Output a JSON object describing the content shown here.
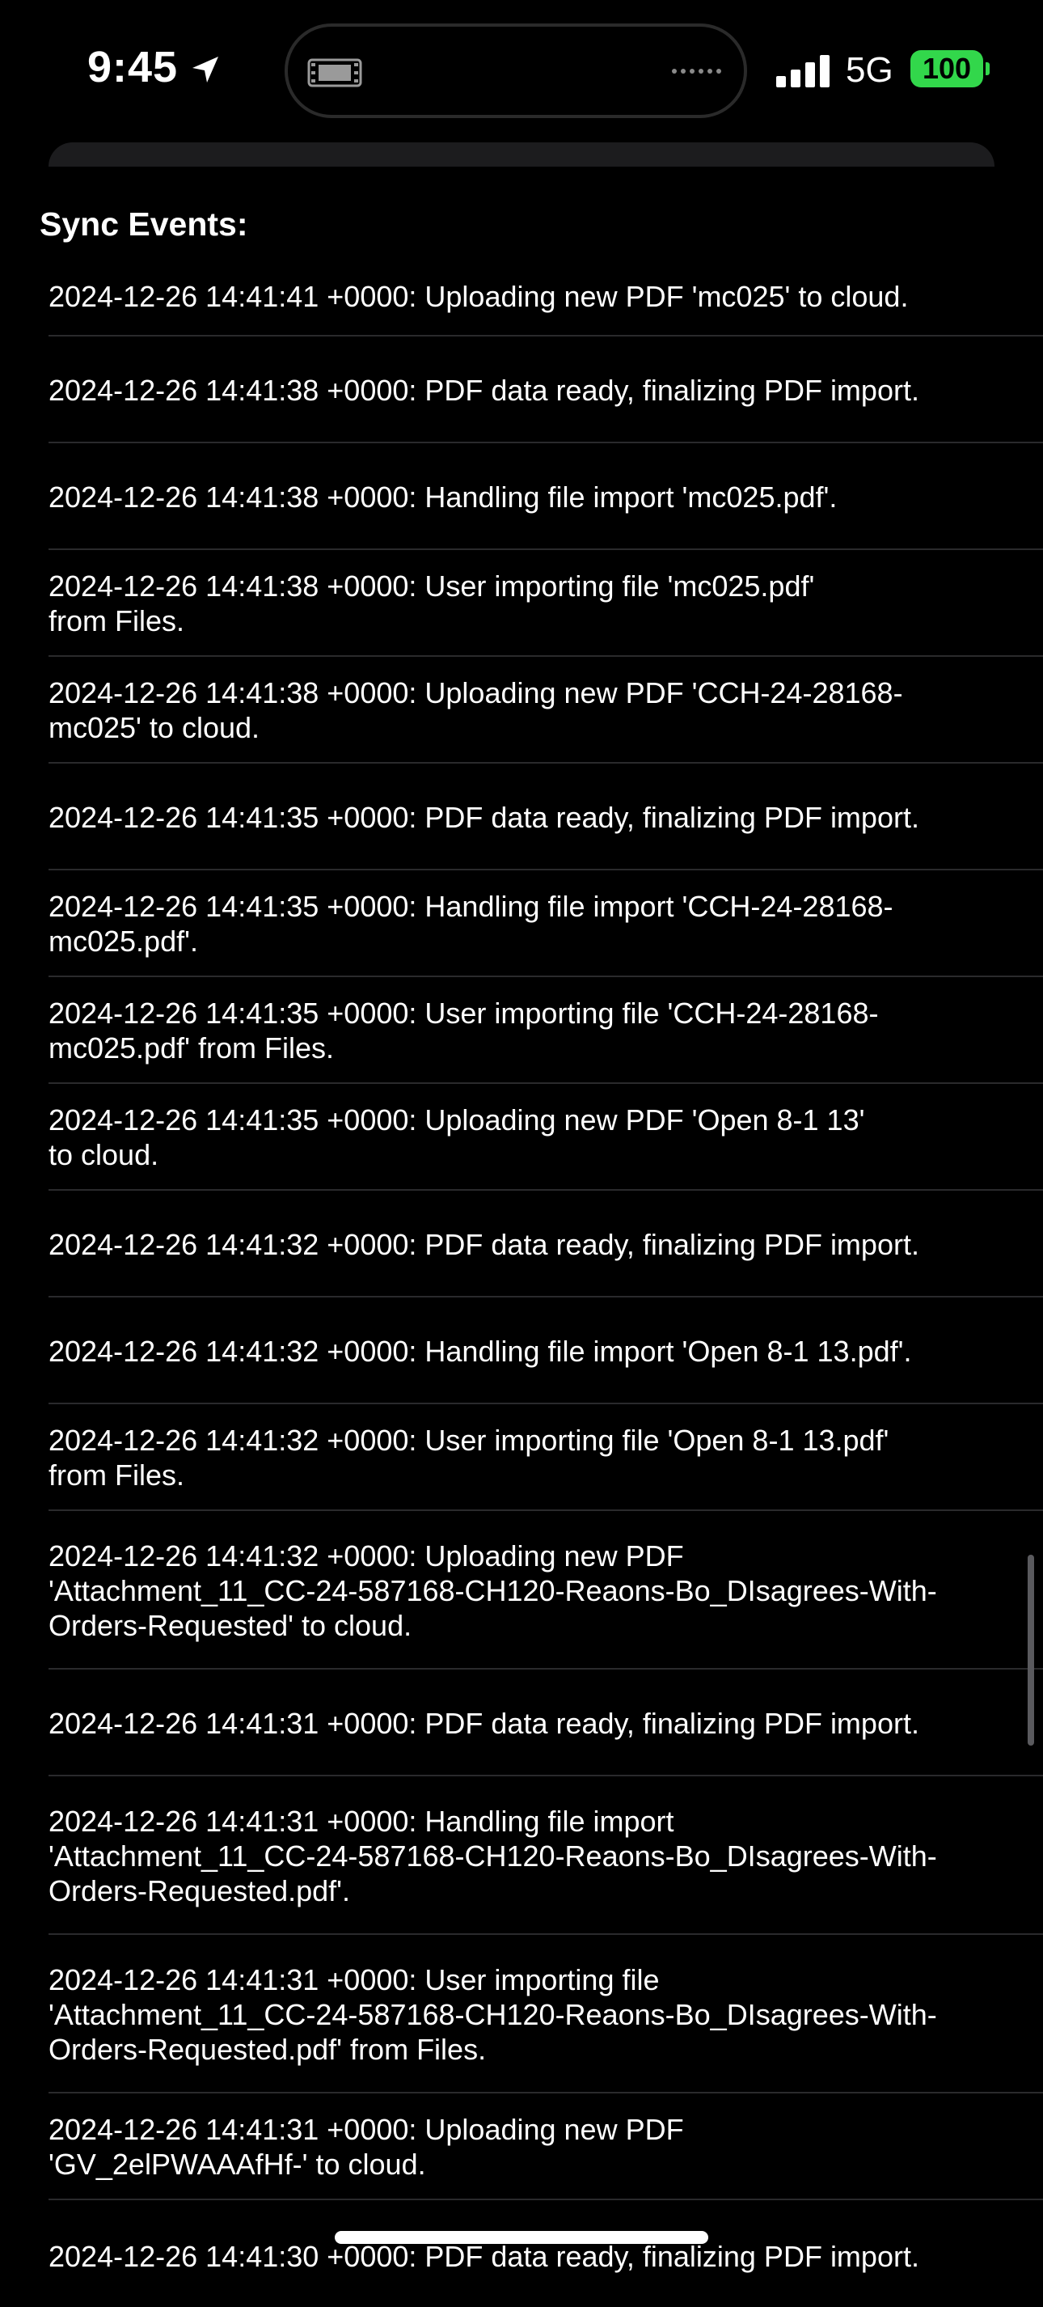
{
  "status_bar": {
    "time": "9:45",
    "network": "5G",
    "battery": "100",
    "battery_color": "#32d74b"
  },
  "section": {
    "title": "Sync Events:"
  },
  "events": [
    "2024-12-26 14:41:41 +0000: Uploading new PDF 'mc025' to cloud.",
    "2024-12-26 14:41:38 +0000: PDF data ready, finalizing PDF import.",
    "2024-12-26 14:41:38 +0000: Handling file import 'mc025.pdf'.",
    "2024-12-26 14:41:38 +0000: User importing file 'mc025.pdf'\nfrom Files.",
    "2024-12-26 14:41:38 +0000: Uploading new PDF 'CCH-24-28168-\nmc025' to cloud.",
    "2024-12-26 14:41:35 +0000: PDF data ready, finalizing PDF import.",
    "2024-12-26 14:41:35 +0000: Handling file import 'CCH-24-28168-\nmc025.pdf'.",
    "2024-12-26 14:41:35 +0000: User importing file 'CCH-24-28168-\nmc025.pdf' from Files.",
    "2024-12-26 14:41:35 +0000: Uploading new PDF 'Open 8-1 13'\nto cloud.",
    "2024-12-26 14:41:32 +0000: PDF data ready, finalizing PDF import.",
    "2024-12-26 14:41:32 +0000: Handling file import 'Open 8-1 13.pdf'.",
    "2024-12-26 14:41:32 +0000: User importing file 'Open 8-1 13.pdf'\nfrom Files.",
    "2024-12-26 14:41:32 +0000: Uploading new PDF\n'Attachment_11_CC-24-587168-CH120-Reaons-Bo_DIsagrees-With-\nOrders-Requested' to cloud.",
    "2024-12-26 14:41:31 +0000: PDF data ready, finalizing PDF import.",
    "2024-12-26 14:41:31 +0000: Handling file import\n'Attachment_11_CC-24-587168-CH120-Reaons-Bo_DIsagrees-With-\nOrders-Requested.pdf'.",
    "2024-12-26 14:41:31 +0000: User importing file\n'Attachment_11_CC-24-587168-CH120-Reaons-Bo_DIsagrees-With-\nOrders-Requested.pdf' from Files.",
    "2024-12-26 14:41:31 +0000: Uploading new PDF\n'GV_2elPWAAAfHf-' to cloud.",
    "2024-12-26 14:41:30 +0000: PDF data ready, finalizing PDF import."
  ]
}
